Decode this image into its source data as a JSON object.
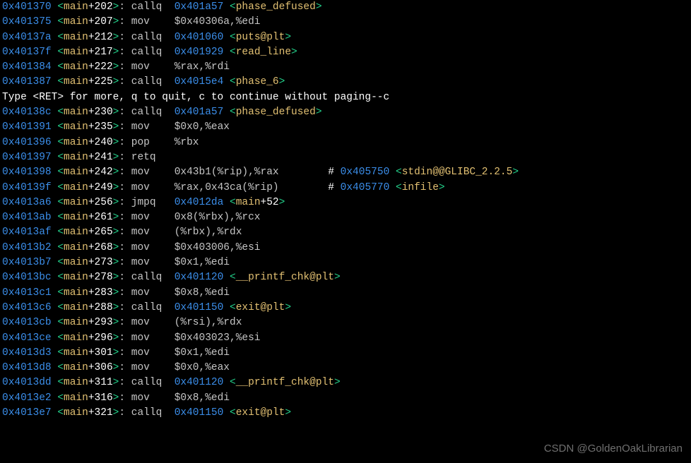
{
  "lines": [
    {
      "addr": "0x401370",
      "func": "main",
      "off": "202",
      "op": "callq",
      "pre": "  ",
      "operand_addr": "0x401a57",
      "sym": "phase_defused"
    },
    {
      "addr": "0x401375",
      "func": "main",
      "off": "207",
      "op": "mov",
      "pre": "    ",
      "literal": "$0x40306a,%edi"
    },
    {
      "addr": "0x40137a",
      "func": "main",
      "off": "212",
      "op": "callq",
      "pre": "  ",
      "operand_addr": "0x401060",
      "sym": "puts@plt"
    },
    {
      "addr": "0x40137f",
      "func": "main",
      "off": "217",
      "op": "callq",
      "pre": "  ",
      "operand_addr": "0x401929",
      "sym": "read_line"
    },
    {
      "addr": "0x401384",
      "func": "main",
      "off": "222",
      "op": "mov",
      "pre": "    ",
      "literal": "%rax,%rdi"
    },
    {
      "addr": "0x401387",
      "func": "main",
      "off": "225",
      "op": "callq",
      "pre": "  ",
      "operand_addr": "0x4015e4",
      "sym": "phase_6"
    },
    {
      "raw": "Type <RET> for more, q to quit, c to continue without paging--c"
    },
    {
      "addr": "0x40138c",
      "func": "main",
      "off": "230",
      "op": "callq",
      "pre": "  ",
      "operand_addr": "0x401a57",
      "sym": "phase_defused"
    },
    {
      "addr": "0x401391",
      "func": "main",
      "off": "235",
      "op": "mov",
      "pre": "    ",
      "literal": "$0x0,%eax"
    },
    {
      "addr": "0x401396",
      "func": "main",
      "off": "240",
      "op": "pop",
      "pre": "    ",
      "literal": "%rbx"
    },
    {
      "addr": "0x401397",
      "func": "main",
      "off": "241",
      "op": "retq"
    },
    {
      "addr": "0x401398",
      "func": "main",
      "off": "242",
      "op": "mov",
      "pre": "    ",
      "literal": "0x43b1(%rip),%rax",
      "tail_pad": "        ",
      "cmt_addr": "0x405750",
      "cmt_sym": "stdin@@GLIBC_2.2.5"
    },
    {
      "addr": "0x40139f",
      "func": "main",
      "off": "249",
      "op": "mov",
      "pre": "    ",
      "literal": "%rax,0x43ca(%rip)",
      "tail_pad": "        ",
      "cmt_addr": "0x405770",
      "cmt_sym": "infile"
    },
    {
      "addr": "0x4013a6",
      "func": "main",
      "off": "256",
      "op": "jmpq",
      "pre": "   ",
      "operand_addr": "0x4012da",
      "offref_func": "main",
      "offref_off": "52"
    },
    {
      "addr": "0x4013ab",
      "func": "main",
      "off": "261",
      "op": "mov",
      "pre": "    ",
      "literal": "0x8(%rbx),%rcx"
    },
    {
      "addr": "0x4013af",
      "func": "main",
      "off": "265",
      "op": "mov",
      "pre": "    ",
      "literal": "(%rbx),%rdx"
    },
    {
      "addr": "0x4013b2",
      "func": "main",
      "off": "268",
      "op": "mov",
      "pre": "    ",
      "literal": "$0x403006,%esi"
    },
    {
      "addr": "0x4013b7",
      "func": "main",
      "off": "273",
      "op": "mov",
      "pre": "    ",
      "literal": "$0x1,%edi"
    },
    {
      "addr": "0x4013bc",
      "func": "main",
      "off": "278",
      "op": "callq",
      "pre": "  ",
      "operand_addr": "0x401120",
      "sym": "__printf_chk@plt"
    },
    {
      "addr": "0x4013c1",
      "func": "main",
      "off": "283",
      "op": "mov",
      "pre": "    ",
      "literal": "$0x8,%edi"
    },
    {
      "addr": "0x4013c6",
      "func": "main",
      "off": "288",
      "op": "callq",
      "pre": "  ",
      "operand_addr": "0x401150",
      "sym": "exit@plt"
    },
    {
      "addr": "0x4013cb",
      "func": "main",
      "off": "293",
      "op": "mov",
      "pre": "    ",
      "literal": "(%rsi),%rdx"
    },
    {
      "addr": "0x4013ce",
      "func": "main",
      "off": "296",
      "op": "mov",
      "pre": "    ",
      "literal": "$0x403023,%esi"
    },
    {
      "addr": "0x4013d3",
      "func": "main",
      "off": "301",
      "op": "mov",
      "pre": "    ",
      "literal": "$0x1,%edi"
    },
    {
      "addr": "0x4013d8",
      "func": "main",
      "off": "306",
      "op": "mov",
      "pre": "    ",
      "literal": "$0x0,%eax"
    },
    {
      "addr": "0x4013dd",
      "func": "main",
      "off": "311",
      "op": "callq",
      "pre": "  ",
      "operand_addr": "0x401120",
      "sym": "__printf_chk@plt"
    },
    {
      "addr": "0x4013e2",
      "func": "main",
      "off": "316",
      "op": "mov",
      "pre": "    ",
      "literal": "$0x8,%edi"
    },
    {
      "addr": "0x4013e7",
      "func": "main",
      "off": "321",
      "op": "callq",
      "pre": "  ",
      "operand_addr": "0x401150",
      "sym": "exit@plt"
    }
  ],
  "watermark": "CSDN @GoldenOakLibrarian"
}
